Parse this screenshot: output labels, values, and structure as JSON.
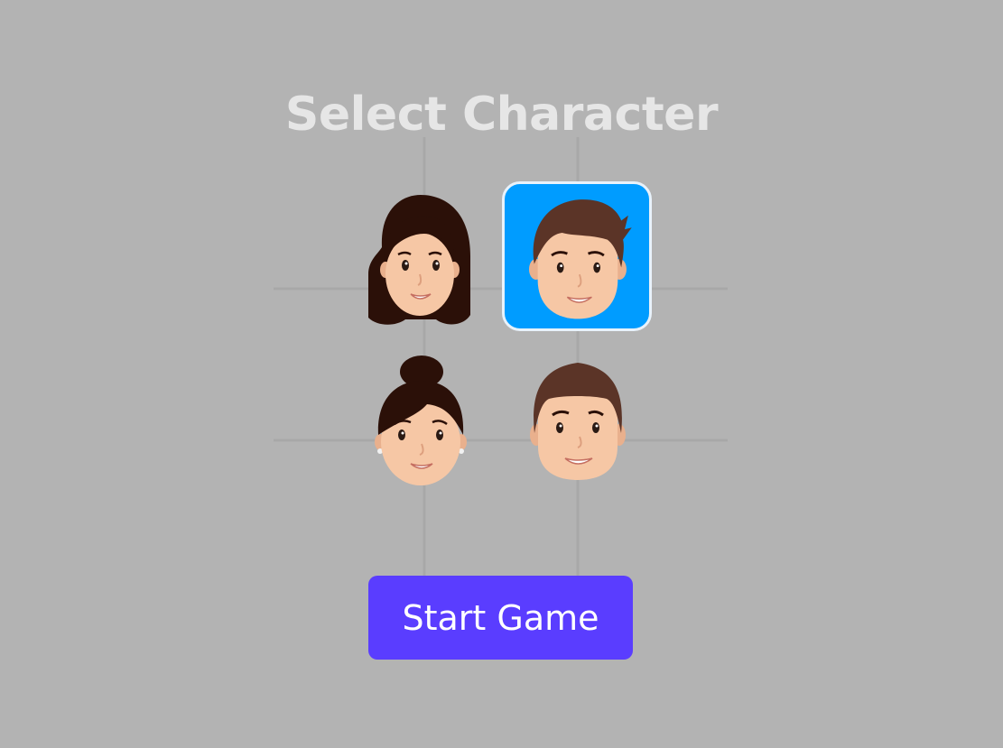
{
  "screen": {
    "title": "Select Character"
  },
  "characters": [
    {
      "name": "woman-long-hair",
      "selected": false
    },
    {
      "name": "man-spiky-hair",
      "selected": true
    },
    {
      "name": "woman-hair-bun",
      "selected": false
    },
    {
      "name": "man-short-hair",
      "selected": false
    }
  ],
  "start_button": {
    "label": "Start Game"
  },
  "colors": {
    "background": "#b3b3b3",
    "title_text": "#e6e6e6",
    "selected_tile": "#009cff",
    "selected_border": "#e8f2fb",
    "button_bg": "#5a3dff",
    "button_text": "#ffffff",
    "skin": "#f6c7a5",
    "dark_hair": "#2b1008",
    "brown_hair": "#5b3427"
  }
}
